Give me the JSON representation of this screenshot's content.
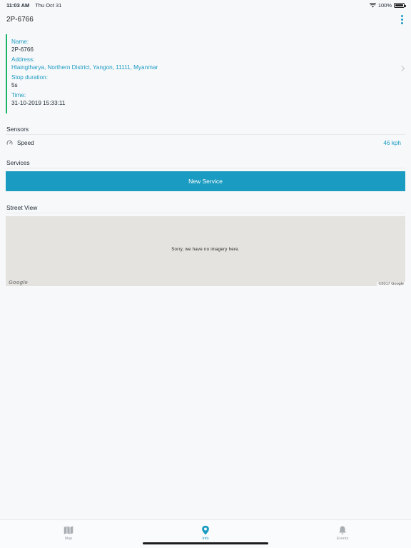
{
  "status_bar": {
    "time": "11:03 AM",
    "date": "Thu Oct 31",
    "battery": "100%"
  },
  "header": {
    "title": "2P-6766"
  },
  "details": {
    "name_label": "Name:",
    "name_value": "2P-6766",
    "address_label": "Address:",
    "address_value": "Hlaingtharya, Northern District, Yangon, 11111, Myanmar",
    "stop_label": "Stop duration:",
    "stop_value": "5s",
    "time_label": "Time:",
    "time_value": "31-10-2019 15:33:11"
  },
  "sensors": {
    "title": "Sensors",
    "items": [
      {
        "icon": "gauge-icon",
        "label": "Speed",
        "value": "46 kph"
      }
    ]
  },
  "services": {
    "title": "Services",
    "button_label": "New Service"
  },
  "street_view": {
    "title": "Street View",
    "message": "Sorry, we have no imagery here.",
    "logo": "Google",
    "copyright": "©2017 Google"
  },
  "tabs": [
    {
      "label": "Map",
      "icon": "map-icon",
      "active": false
    },
    {
      "label": "Info",
      "icon": "location-pin-icon",
      "active": true
    },
    {
      "label": "Events",
      "icon": "bell-icon",
      "active": false
    }
  ],
  "colors": {
    "accent": "#1a9bc2",
    "indicator": "#1bb36a",
    "inactive": "#9aa0a6"
  }
}
